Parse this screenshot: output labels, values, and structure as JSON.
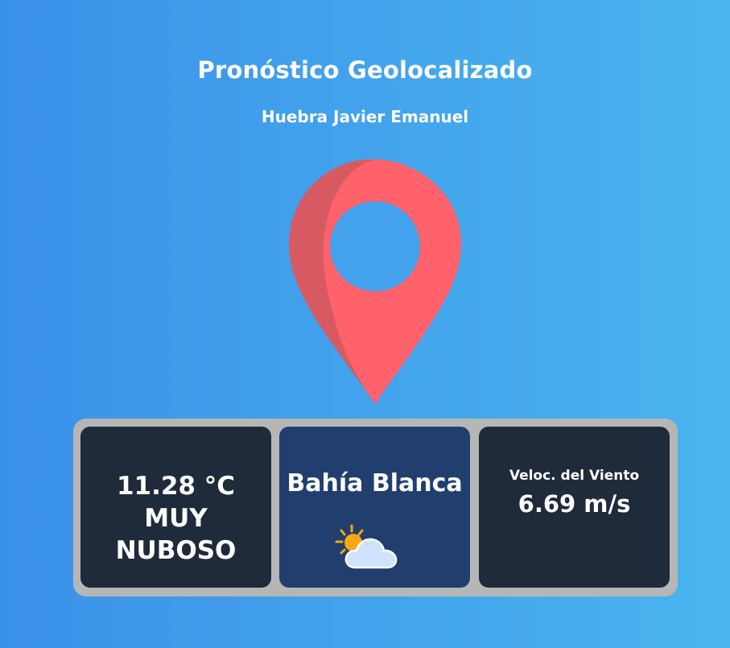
{
  "header": {
    "title": "Pronóstico Geolocalizado",
    "author": "Huebra Javier Emanuel"
  },
  "map_pin": {
    "icon": "location-pin-icon",
    "color": "#ff626b",
    "shadow_color": "#d75a62"
  },
  "weather": {
    "temperature": "11.28 °C",
    "description": "MUY NUBOSO",
    "city": "Bahía Blanca",
    "condition_icon": "sun-behind-cloud-icon",
    "wind_label": "Veloc. del Viento",
    "wind_value": "6.69 m/s"
  },
  "colors": {
    "background_start": "#3b91e9",
    "background_end": "#4ab5ef",
    "panel": "#b6b6b6",
    "card_dark": "#1f2a3b",
    "card_blue": "#203f6f"
  }
}
